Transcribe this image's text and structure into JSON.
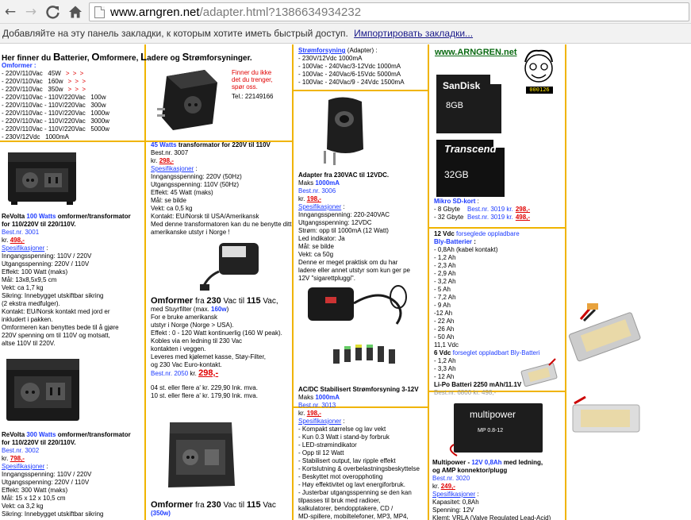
{
  "browser": {
    "back_icon": "back-arrow-icon",
    "forward_icon": "forward-arrow-icon",
    "reload_icon": "reload-icon",
    "home_icon": "home-icon",
    "url_host": "www.arngren.net",
    "url_path": "/adapter.html?1386634934232"
  },
  "bookmarks_bar": {
    "message": "Добавляйте на эту панель закладки, к которым хотите иметь быстрый доступ.",
    "import_link": "Импортировать закладки..."
  },
  "page": {
    "title_parts": [
      "Her finner du ",
      "B",
      "atterier, ",
      "O",
      "mformere, ",
      "L",
      "adere og ",
      "S",
      "trømforsyninger."
    ],
    "col1": {
      "omformer_header": "Omformer :",
      "omformer_items": [
        {
          "text": "- 220V/110Vac   45W",
          "arrows": "> > >"
        },
        {
          "text": "- 220V/110Vac   160w",
          "arrows": "> > >"
        },
        {
          "text": "- 220V/110Vac   350w",
          "arrows": "> > >"
        },
        {
          "text": "- 220V/110Vac - 110V/220Vac   100w",
          "arrows": ""
        },
        {
          "text": "- 220V/110Vac - 110V/220Vac   300w",
          "arrows": ""
        },
        {
          "text": "- 220V/110Vac - 110V/220Vac   1000w",
          "arrows": ""
        },
        {
          "text": "- 220V/110Vac - 110V/220Vac   3000w",
          "arrows": ""
        },
        {
          "text": "- 220V/110Vac - 110V/220Vac   5000w",
          "arrows": ""
        },
        {
          "text": "- 230V/12Vdc   1000mA",
          "arrows": ""
        }
      ],
      "p1": {
        "title_a": "ReVolta ",
        "title_b": "100 Watts",
        "title_c": " omformer/transformator",
        "title_d": "for 110/220V til 220/110V.",
        "bestnr": "Best.nr. 3001",
        "kr": "kr.",
        "price": "498,-",
        "spec_label": "Spesifikasjoner",
        "lines": [
          "Inngangsspenning: 110V / 220V",
          "Utgangsspenning: 220V / 110V",
          "Effekt: 100 Watt (maks)",
          "Mål: 13x8,5x9,5 cm",
          "Vekt: ca 1,7 kg",
          "Sikring: Innebygget utskiftbar sikring",
          "(2 ekstra medfulger).",
          "Kontakt: EU/Norsk kontakt med jord er",
          "inkludert i pakken.",
          "Omformeren kan benyttes bede til å gjøre",
          "220V spenning om til 110V og motsatt,",
          "altse 110V til 220V."
        ]
      },
      "p2": {
        "title_a": "ReVolta ",
        "title_b": "300 Watts",
        "title_c": " omformer/transformator",
        "title_d": "for 110/220V til 220/110V.",
        "bestnr": "Best.nr. 3002",
        "kr": "kr.",
        "price": "798,-",
        "spec_label": "Spesifikasjoner",
        "lines": [
          "Inngangsspenning: 110V / 220V",
          "Utgangsspenning: 220V / 110V",
          "Effekt: 300 Watt (maks)",
          "Mål: 15 x 12 x 10,5 cm",
          "Vekt: ca 3,2 kg",
          "Sikring: Innebygget utskiftbar sikring"
        ]
      }
    },
    "col2": {
      "note_red": [
        "Finner du ikke",
        "det du trenger,",
        "spør oss."
      ],
      "note_tel": "Tel.: 22149166",
      "p1": {
        "title_a": "45 Watts",
        "title_b": " transformator for 220V til 110V",
        "bestnr": "Best.nr. 3007",
        "kr": "kr.",
        "price": "298,-",
        "spec_label": "Spesifikasjoner",
        "lines": [
          "Inngangsspenning: 220V (50Hz)",
          "Utgangsspenning: 110V (50Hz)",
          "Effekt: 45 Watt (maks)",
          "Mål: se bilde",
          "Vekt: ca 0,5 kg",
          "Kontakt: EU/Norsk til USA/Amerikansk",
          "Med denne transformatoren kan du ne benytte ditt",
          "amerikanske utstyr i Norge !"
        ]
      },
      "p2": {
        "title_a": "Omformer",
        "title_b": " fra ",
        "title_c": "230",
        "title_d": " Vac til ",
        "title_e": "115",
        "title_f": " Vac,",
        "line1a": "med Stuyrfilter (max. ",
        "line1b": "160w",
        "line1c": ")",
        "lines": [
          "For e bruke amerikansk",
          "utstyr i Norge (Norge > USA).",
          "Effekt : 0 - 120 Watt kontinuerlig (160 W peak).",
          "Kobles via en ledning til 230 Vac",
          "kontakten i veggen.",
          "Leveres med kjølemet kasse, Støy-Filter,",
          "og 230 Vac Euro-kontakt."
        ],
        "bestnr": "Best.nr. 2050",
        "kr": "kr.",
        "price": "298,-",
        "qty1": "04  st. eller flere a'  kr. 229,90  Ink. mva.",
        "qty2": "10 st. eller flere a'  kr.  179,90  Ink. mva."
      },
      "p3": {
        "title_a": "Omformer",
        "title_b": " fra ",
        "title_c": "230",
        "title_d": " Vac til ",
        "title_e": "115",
        "title_f": " Vac",
        "line1": "(350w)"
      }
    },
    "col3": {
      "top_header": "Strømforsyning",
      "top_header_b": " (Adapter) :",
      "top_items": [
        "- 230V/12Vdc   1000mA",
        "- 100Vac - 240Vac/3-12Vdc   1000mA",
        "- 100Vac - 240Vac/6-15Vdc   5000mA",
        "- 100Vac - 240Vac/9 - 24Vdc   1500mA"
      ],
      "p1": {
        "title": "Adapter fra 230VAC til 12VDC.",
        "maks_a": "Maks ",
        "maks_b": "1000mA",
        "bestnr": "Best.nr. 3006",
        "kr": "kr.",
        "price": "198,-",
        "spec_label": "Spesifikasjoner",
        "lines": [
          "Inngangsspenning: 220-240VAC",
          "Utgangsspenning: 12VDC",
          "Strøm: opp til 1000mA (12 Watt)",
          "Led indikator: Ja",
          "Mål: se bilde",
          "Vekt: ca 50g",
          "Denne er meget praktisk om du har",
          "ladere eller annet utstyr som kun ger pe",
          "12V \"sigarettpluggi\"."
        ]
      },
      "p2": {
        "title": "AC/DC Stabilisert Strømforsyning 3-12V",
        "maks_a": "Maks ",
        "maks_b": "1000mA",
        "bestnr": "Best.nr. 3013",
        "kr": "kr.",
        "price": "198,-",
        "spec_label": "Spesifikasjoner",
        "lines": [
          "- Kompakt størrelse og lav vekt",
          "- Kun 0.3 Watt i stand-by forbruk",
          "- LED-strømindikator",
          "- Opp til 12 Watt",
          "- Stabilisert output, lav ripple effekt",
          "- Kortslutning & overbelastningsbeskyttelse",
          "- Beskyttet mot overopphoting",
          "- Høy effektivitet og lavt energiforbruk.",
          "- Justerbar utgangsspenning se den kan",
          "  tilpasses til bruk med radioer,",
          "  kalkulatorer, bendopptakere, CD /",
          "  MD-spillere, mobiltelefoner, MP3, MP4,"
        ]
      }
    },
    "col4": {
      "logo": "www.ARNGREN.net",
      "counter": "000126",
      "sd1_brand": "SanDisk",
      "sd1_cap": "8GB",
      "sd2_brand": "Transcend",
      "sd2_cap": "32GB",
      "micro_header": "Mikro SD-kort",
      "micro_header_b": " :",
      "micro_items": [
        {
          "cap": "- 8 Gbyte",
          "bestnr": "Best.nr. 3019 kr.",
          "price": "298,-"
        },
        {
          "cap": "- 32 Gbyte",
          "bestnr": "Best.nr. 3019 kr.",
          "price": "498,-"
        }
      ],
      "bly_header_a": "12 Vdc",
      "bly_header_b": " forseglede oppladbare",
      "bly_header_c": "Bly-Batterier",
      "bly_header_d": " :",
      "bly_items": [
        "- 0,8Ah (kabel kontakt)",
        "- 1,2 Ah",
        "- 2,3 Ah",
        "- 2,9 Ah",
        "- 3,2 Ah",
        "- 5 Ah",
        "- 7,2 Ah",
        "- 9 Ah",
        "-12 Ah",
        "- 22 Ah",
        "- 26 Ah",
        "- 50 Ah",
        "11,1 Vdc"
      ],
      "sixv_a": "6 Vdc",
      "sixv_b": " forseglet oppladbart Bly-Batteri",
      "sixv_items": [
        "- 1,2 Ah",
        "- 3,3 Ah",
        "- 12 Ah"
      ],
      "lipo": "Li-Po Batteri  2250 mAh/11.1V",
      "partial_bestnr": "Best.nr. 6800 kr. 498,-",
      "mp_brand": "multipower",
      "mp_model": "MP 0.8-12",
      "mp": {
        "title_a": "Multipower",
        "title_b": " - ",
        "title_c": "12V 0,8Ah",
        "title_d": " med ledning,",
        "title_e": "og AMP konnektor/plugg",
        "bestnr": "Best.nr. 3020",
        "kr": "kr.",
        "price": "249,-",
        "spec_label": "Spesifikasjoner",
        "lines": [
          "Kapasitet: 0,8Ah",
          "Spenning: 12V",
          "Klemt: VRLA (Valve Regulated Lead-Acid)"
        ]
      }
    }
  }
}
